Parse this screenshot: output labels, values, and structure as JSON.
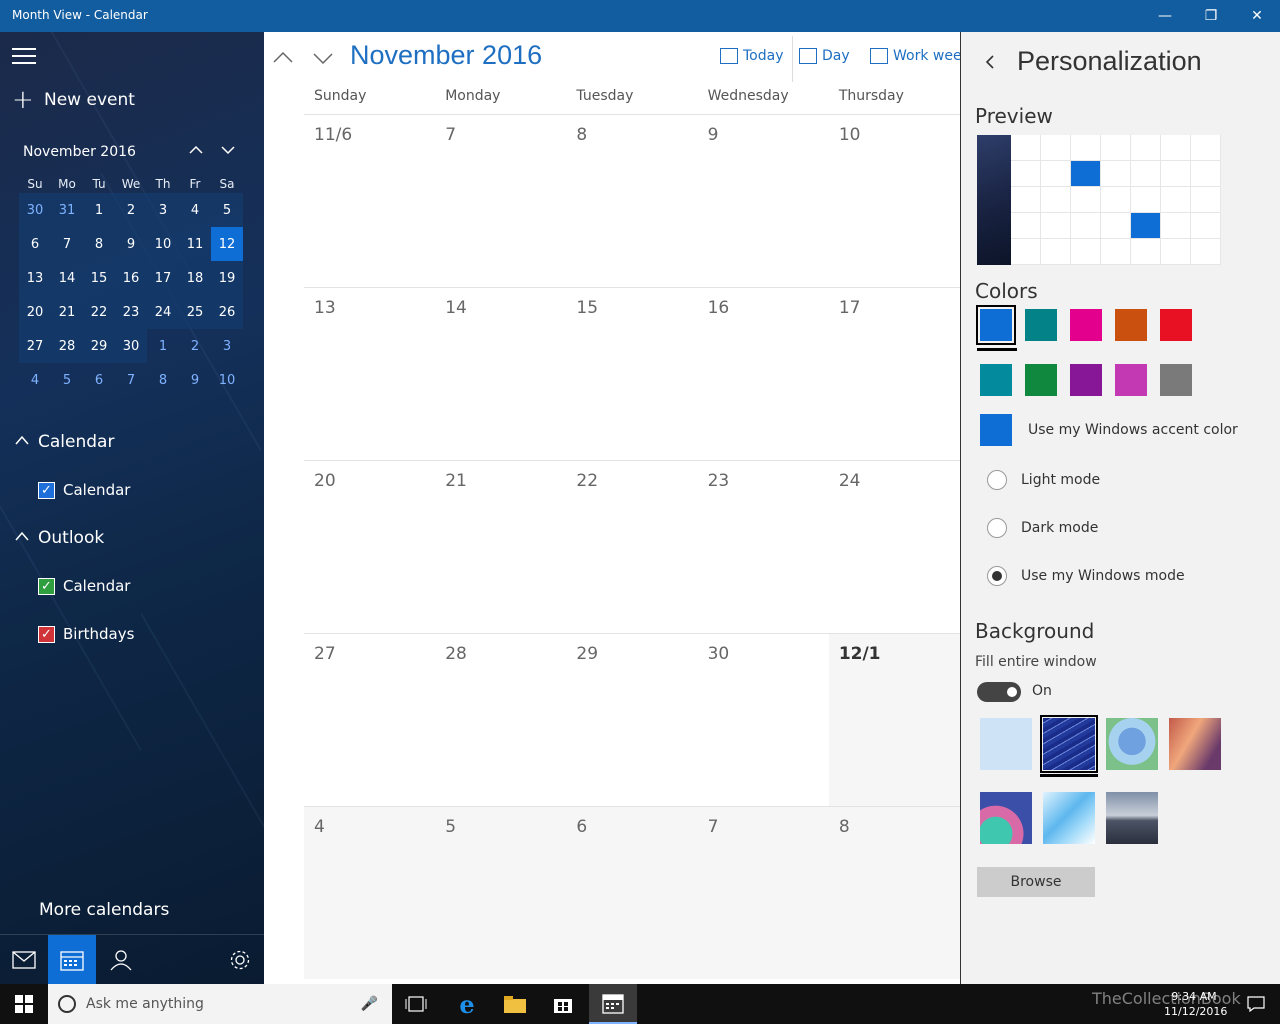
{
  "window": {
    "title": "Month View - Calendar",
    "minimize": "—",
    "restore": "❐",
    "close": "✕"
  },
  "sidebar": {
    "new_event": "New event",
    "mini_month": "November 2016",
    "weekdays": [
      "Su",
      "Mo",
      "Tu",
      "We",
      "Th",
      "Fr",
      "Sa"
    ],
    "weeks": [
      [
        "30",
        "31",
        "1",
        "2",
        "3",
        "4",
        "5"
      ],
      [
        "6",
        "7",
        "8",
        "9",
        "10",
        "11",
        "12"
      ],
      [
        "13",
        "14",
        "15",
        "16",
        "17",
        "18",
        "19"
      ],
      [
        "20",
        "21",
        "22",
        "23",
        "24",
        "25",
        "26"
      ],
      [
        "27",
        "28",
        "29",
        "30",
        "1",
        "2",
        "3"
      ],
      [
        "4",
        "5",
        "6",
        "7",
        "8",
        "9",
        "10"
      ]
    ],
    "groups": [
      {
        "name": "Calendar",
        "items": [
          {
            "label": "Calendar",
            "color": "#1e6fd9"
          }
        ]
      },
      {
        "name": "Outlook",
        "items": [
          {
            "label": "Calendar",
            "color": "#2e9e3e"
          },
          {
            "label": "Birthdays",
            "color": "#d13438"
          }
        ]
      }
    ],
    "more_calendars": "More calendars"
  },
  "main": {
    "month_title": "November 2016",
    "views": {
      "today": "Today",
      "day": "Day",
      "work_week": "Work week"
    },
    "day_headers": [
      "Sunday",
      "Monday",
      "Tuesday",
      "Wednesday",
      "Thursday"
    ],
    "weeks": [
      [
        "11/6",
        "7",
        "8",
        "9",
        "10"
      ],
      [
        "13",
        "14",
        "15",
        "16",
        "17"
      ],
      [
        "20",
        "21",
        "22",
        "23",
        "24"
      ],
      [
        "27",
        "28",
        "29",
        "30",
        "12/1"
      ],
      [
        "4",
        "5",
        "6",
        "7",
        "8"
      ]
    ]
  },
  "panel": {
    "title": "Personalization",
    "preview_label": "Preview",
    "colors_label": "Colors",
    "colors": [
      "#0f6ed6",
      "#038387",
      "#e3008c",
      "#ca5010",
      "#e81123",
      "#038a9c",
      "#10893e",
      "#881798",
      "#c239b3",
      "#7a7a7a"
    ],
    "accent_label": "Use my Windows accent color",
    "modes": [
      {
        "label": "Light mode",
        "checked": false
      },
      {
        "label": "Dark mode",
        "checked": false
      },
      {
        "label": "Use my Windows mode",
        "checked": true
      }
    ],
    "background_label": "Background",
    "fill_label": "Fill entire window",
    "toggle_state": "On",
    "browse": "Browse"
  },
  "taskbar": {
    "search_placeholder": "Ask me anything",
    "time": "9:34 AM",
    "date": "11/12/2016",
    "watermark": "TheCollectionBook"
  }
}
